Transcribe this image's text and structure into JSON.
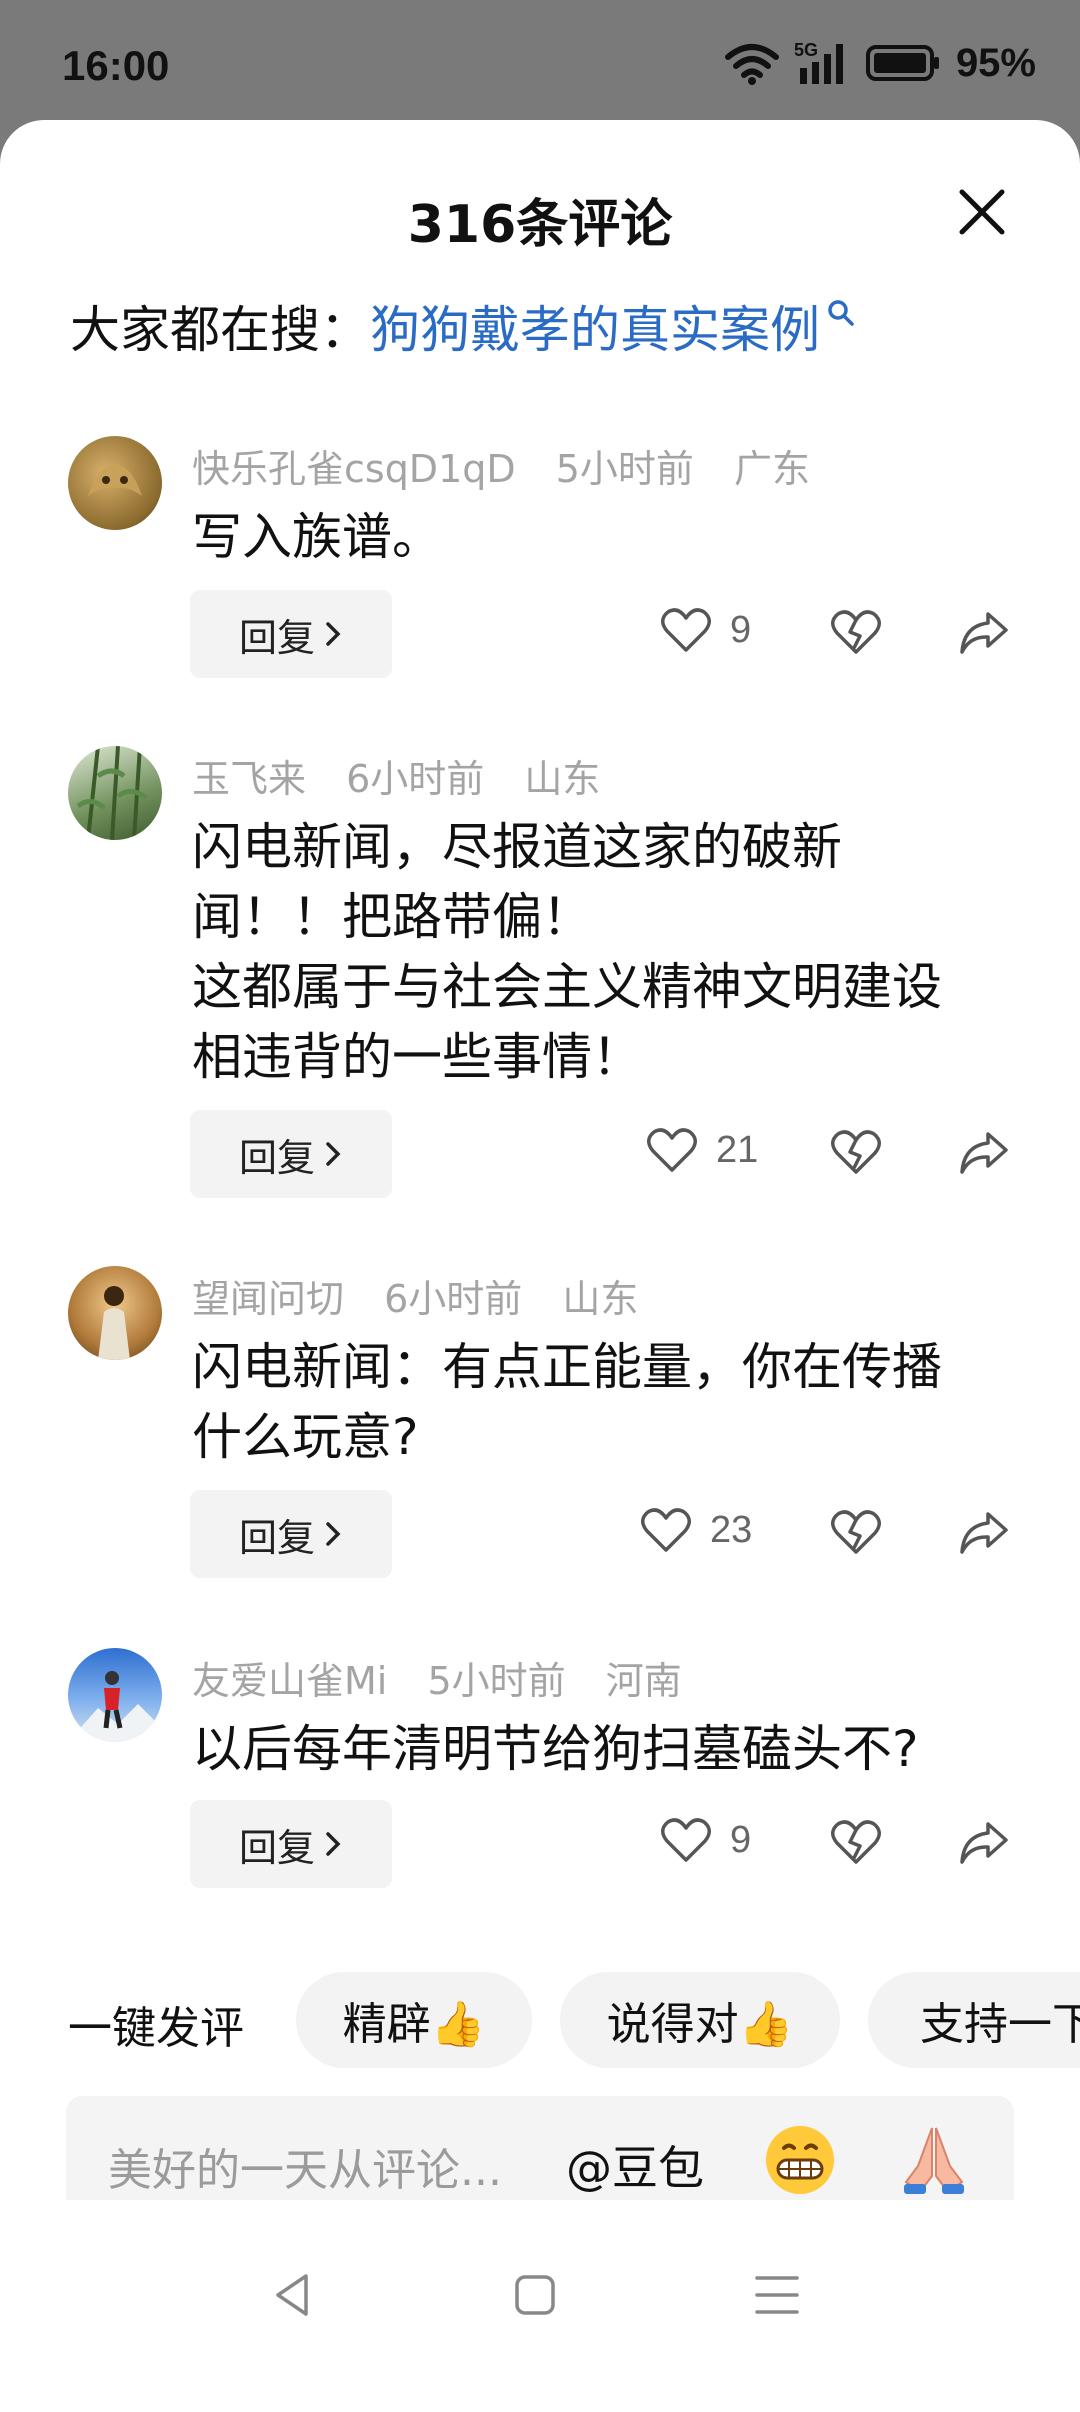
{
  "status_bar": {
    "time": "16:00",
    "network": "5G",
    "battery": "95%"
  },
  "sheet": {
    "title": "316条评论",
    "search_prefix": "大家都在搜：",
    "search_link": "狗狗戴孝的真实案例"
  },
  "comments": [
    {
      "user": "快乐孔雀csqD1qD",
      "time": "5小时前",
      "location": "广东",
      "lines": [
        "写入族谱。"
      ],
      "likes": "9",
      "reply_label": "回复"
    },
    {
      "user": "玉飞来",
      "time": "6小时前",
      "location": "山东",
      "lines": [
        "闪电新闻，尽报道这家的破新",
        "闻！！把路带偏！",
        "这都属于与社会主义精神文明建设",
        "相违背的一些事情！"
      ],
      "likes": "21",
      "reply_label": "回复"
    },
    {
      "user": "望闻问切",
      "time": "6小时前",
      "location": "山东",
      "lines": [
        "闪电新闻：有点正能量，你在传播",
        "什么玩意?"
      ],
      "likes": "23",
      "reply_label": "回复"
    },
    {
      "user": "友爱山雀Mi",
      "time": "5小时前",
      "location": "河南",
      "lines": [
        "以后每年清明节给狗扫墓磕头不?"
      ],
      "likes": "9",
      "reply_label": "回复"
    }
  ],
  "quick_comment": {
    "label": "一键发评",
    "chips": [
      "精辟👍",
      "说得对👍",
      "支持一下"
    ]
  },
  "composer": {
    "placeholder": "美好的一天从评论...",
    "mention": "@豆包"
  },
  "colors": {
    "link": "#2a6bc4",
    "meta": "#a4a4a4",
    "status_bg": "#7a7a7a"
  }
}
